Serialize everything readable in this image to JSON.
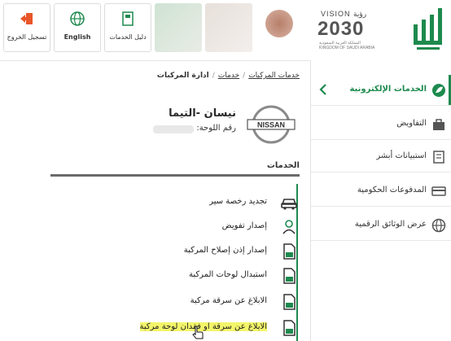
{
  "topbar": {
    "logout_label": "تسجيل الخروج",
    "english_label": "English",
    "guide_label": "دليل الخدمات",
    "vision_text": "VISION رؤية",
    "vision_year": "2030",
    "kingdom_line1": "المملكة العربية السعودية",
    "kingdom_line2": "KINGDOM OF SAUDI ARABIA"
  },
  "sidebar": {
    "items": [
      {
        "label": "الخدمات الإلكترونية",
        "icon": "leaf-icon",
        "active": true
      },
      {
        "label": "التفاويض",
        "icon": "briefcase-icon"
      },
      {
        "label": "استبيانات أبشر",
        "icon": "survey-icon"
      },
      {
        "label": "المدفوعات الحكومية",
        "icon": "card-icon"
      },
      {
        "label": "عرض الوثائق الرقمية",
        "icon": "globe-icon"
      }
    ]
  },
  "breadcrumb": {
    "item1": "خدمات المركبات",
    "item2": "خدمات",
    "item3": "ادارة المركبات"
  },
  "vehicle": {
    "name": "نيسان -التيما",
    "plate_label": "رقم اللوحة:",
    "brand_logo_text": "NISSAN"
  },
  "services": {
    "title": "الخدمات",
    "items": [
      {
        "label": "تجديد رخصة سير",
        "icon": "car-icon"
      },
      {
        "label": "إصدار تفويض",
        "icon": "user-icon"
      },
      {
        "label": "إصدار إذن إصلاح المركبة",
        "icon": "document-icon"
      },
      {
        "label": "استبدال لوحات المركبة",
        "icon": "document-icon"
      },
      {
        "label": "الابلاغ عن سرقة مركبة",
        "icon": "document-icon"
      },
      {
        "label": "الابلاغ عن سرقة او فقدان لوحة مركبة",
        "icon": "document-icon",
        "highlighted": true
      }
    ]
  },
  "colors": {
    "accent": "#1d8a4e",
    "logout": "#e8562a",
    "highlight": "#f3f56a"
  }
}
